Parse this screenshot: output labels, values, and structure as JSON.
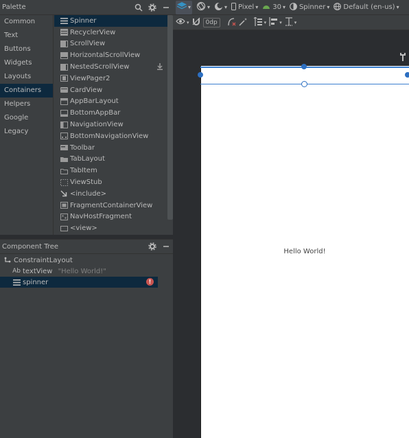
{
  "palette": {
    "title": "Palette",
    "categories": [
      "Common",
      "Text",
      "Buttons",
      "Widgets",
      "Layouts",
      "Containers",
      "Helpers",
      "Google",
      "Legacy"
    ],
    "selected_category": "Containers",
    "widgets": [
      {
        "label": "Spinner",
        "icon": "spinner-icon"
      },
      {
        "label": "RecyclerView",
        "icon": "list-icon"
      },
      {
        "label": "ScrollView",
        "icon": "list-icon"
      },
      {
        "label": "HorizontalScrollView",
        "icon": "horizontal-scroll-icon"
      },
      {
        "label": "NestedScrollView",
        "icon": "list-icon"
      },
      {
        "label": "ViewPager2",
        "icon": "viewpager-icon"
      },
      {
        "label": "CardView",
        "icon": "card-icon"
      },
      {
        "label": "AppBarLayout",
        "icon": "appbar-icon"
      },
      {
        "label": "BottomAppBar",
        "icon": "bottom-appbar-icon"
      },
      {
        "label": "NavigationView",
        "icon": "navigation-view-icon"
      },
      {
        "label": "BottomNavigationView",
        "icon": "bottom-navigation-icon"
      },
      {
        "label": "Toolbar",
        "icon": "toolbar-icon"
      },
      {
        "label": "TabLayout",
        "icon": "tab-layout-icon"
      },
      {
        "label": "TabItem",
        "icon": "tab-item-icon"
      },
      {
        "label": "ViewStub",
        "icon": "viewstub-icon"
      },
      {
        "label": "<include>",
        "icon": "include-icon"
      },
      {
        "label": "FragmentContainerView",
        "icon": "fragment-icon"
      },
      {
        "label": "NavHostFragment",
        "icon": "navhost-icon"
      },
      {
        "label": "<view>",
        "icon": "view-icon"
      }
    ]
  },
  "component_tree": {
    "title": "Component Tree",
    "nodes": [
      {
        "label": "ConstraintLayout",
        "icon_text": "",
        "hint": ""
      },
      {
        "label": "textView",
        "icon_text": "Ab",
        "hint": "\"Hello World!\""
      },
      {
        "label": "spinner",
        "icon_text": "",
        "hint": ""
      }
    ]
  },
  "toolbar": {
    "device": "Pixel",
    "api": "30",
    "theme": "Spinner",
    "locale": "Default (en-us)"
  },
  "toolbar2": {
    "margin": "0dp"
  },
  "design": {
    "hello_text": "Hello World!"
  },
  "colors": {
    "panel_bg": "#3c3f41",
    "selection": "#0d293e",
    "accent": "#3a7fcf",
    "error": "#c75450"
  }
}
